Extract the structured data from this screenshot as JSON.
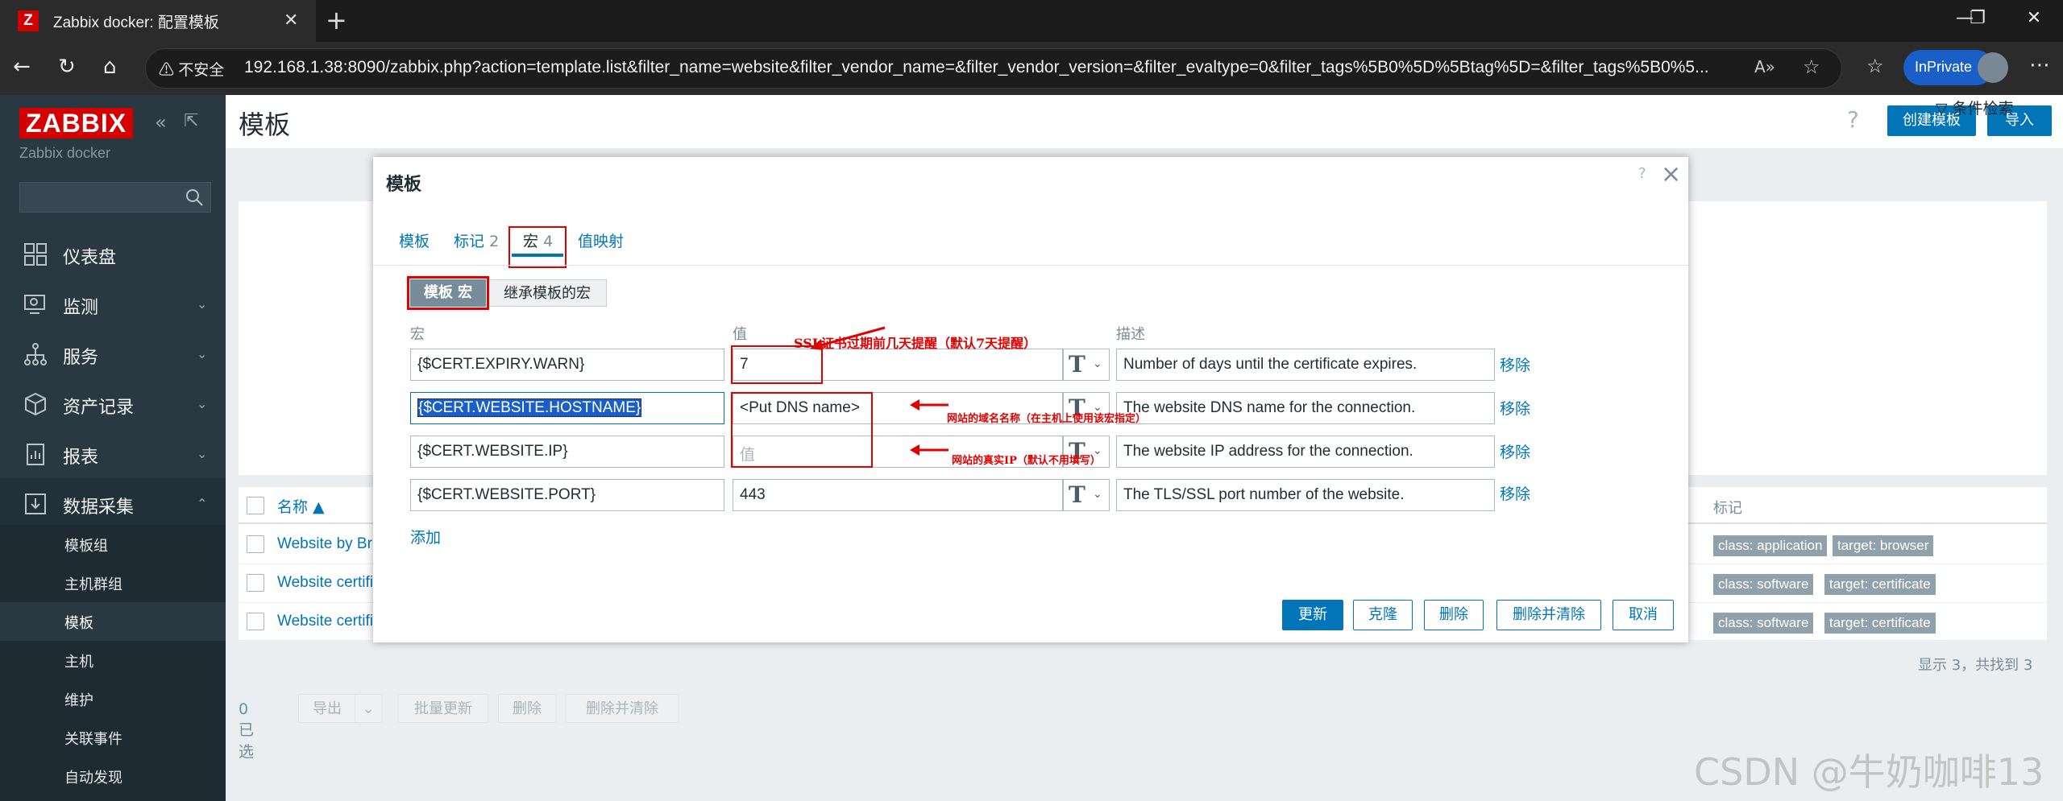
{
  "browser": {
    "tab_favicon": "Z",
    "tab_title": "Zabbix docker: 配置模板",
    "url_warning": "不安全",
    "url": "192.168.1.38:8090/zabbix.php?action=template.list&filter_name=website&filter_vendor_name=&filter_vendor_version=&filter_evaltype=0&filter_tags%5B0%5D%5Btag%5D=&filter_tags%5B0%5...",
    "inprivate_label": "InPrivate"
  },
  "sidebar": {
    "logo": "ZABBIX",
    "instance_name": "Zabbix docker",
    "search_placeholder": "",
    "items": [
      {
        "label": "仪表盘",
        "icon": "dashboard-icon"
      },
      {
        "label": "监测",
        "icon": "monitoring-icon"
      },
      {
        "label": "服务",
        "icon": "services-icon"
      },
      {
        "label": "资产记录",
        "icon": "inventory-icon"
      },
      {
        "label": "报表",
        "icon": "reports-icon"
      },
      {
        "label": "数据采集",
        "icon": "data-collection-icon"
      }
    ],
    "subitems": [
      "模板组",
      "主机群组",
      "模板",
      "主机",
      "维护",
      "关联事件",
      "自动发现"
    ],
    "active_subitem": "模板"
  },
  "header": {
    "title": "模板",
    "help": "?",
    "create_button": "创建模板",
    "import_button": "导入",
    "filter_label": "条件检索"
  },
  "table": {
    "col_name": "名称 ▲",
    "col_tags": "标记",
    "rows": [
      {
        "name": "Website by Br",
        "tags": [
          "class: application",
          "target: browser"
        ]
      },
      {
        "name": "Website certifi",
        "tags": [
          "class: software",
          "target: certificate"
        ]
      },
      {
        "name": "Website certifi",
        "tags": [
          "class: software",
          "target: certificate"
        ]
      }
    ],
    "displaying": "显示 3，共找到 3",
    "selected": "0 已选",
    "actions": [
      "导出",
      "批量更新",
      "删除",
      "删除并清除"
    ]
  },
  "dialog": {
    "title": "模板",
    "help": "?",
    "tabs": [
      {
        "label": "模板",
        "count": ""
      },
      {
        "label": "标记",
        "count": "2"
      },
      {
        "label": "宏",
        "count": "4"
      },
      {
        "label": "值映射",
        "count": ""
      }
    ],
    "seg_template": "模板 宏",
    "seg_inherited": "继承模板的宏",
    "col_macro": "宏",
    "col_value": "值",
    "col_desc": "描述",
    "macros": [
      {
        "macro": "{$CERT.EXPIRY.WARN}",
        "value": "7",
        "value_placeholder": "",
        "desc": "Number of days until the certificate expires.",
        "remove": "移除"
      },
      {
        "macro": "{$CERT.WEBSITE.HOSTNAME}",
        "value": "<Put DNS name>",
        "value_placeholder": "",
        "desc": "The website DNS name for the connection.",
        "remove": "移除"
      },
      {
        "macro": "{$CERT.WEBSITE.IP}",
        "value": "",
        "value_placeholder": "值",
        "desc": "The website IP address for the connection.",
        "remove": "移除"
      },
      {
        "macro": "{$CERT.WEBSITE.PORT}",
        "value": "443",
        "value_placeholder": "",
        "desc": "The TLS/SSL port number of the website.",
        "remove": "移除"
      }
    ],
    "type_glyph": "T",
    "add_link": "添加",
    "buttons": {
      "update": "更新",
      "clone": "克隆",
      "delete": "删除",
      "delete_clear": "删除并清除",
      "cancel": "取消"
    }
  },
  "annotations": {
    "ssl_note": "SSL证书过期前几天提醒（默认7天提醒）",
    "dns_note": "网站的域名名称（在主机上使用该宏指定）",
    "ip_note": "网站的真实IP（默认不用填写）"
  },
  "watermark": "CSDN @牛奶咖啡13",
  "colors": {
    "accent": "#0275b8",
    "logo": "#d40000",
    "annotation": "#e00000",
    "sidebar": "#2a3841"
  }
}
